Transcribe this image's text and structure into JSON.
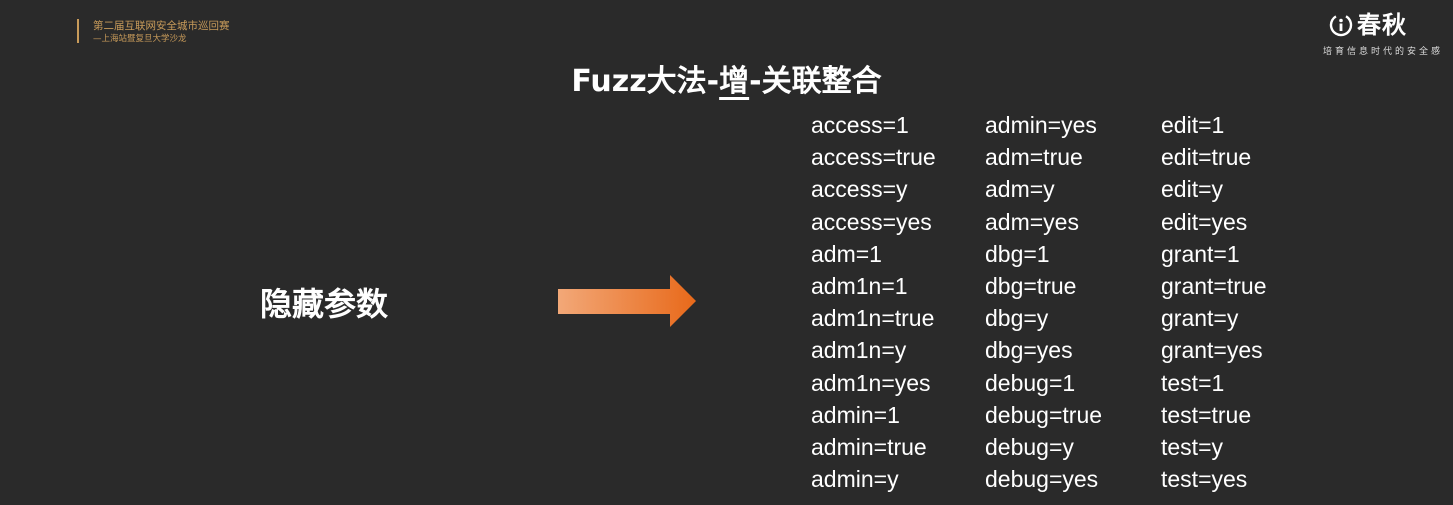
{
  "event": {
    "title": "第二届互联网安全城市巡回赛",
    "subtitle": "—上海站暨复旦大学沙龙"
  },
  "brand": {
    "name": "春秋",
    "slogan": "培育信息时代的安全感"
  },
  "slide": {
    "title_prefix": "Fuzz大法-",
    "title_emphasis": "增",
    "title_suffix": "-关联整合",
    "left_label": "隐藏参数"
  },
  "colors": {
    "background": "#2a2a2a",
    "accent_gold": "#c89b5a",
    "arrow_start": "#f2a878",
    "arrow_end": "#e8691a"
  },
  "params": {
    "columns": [
      [
        "access=1",
        "access=true",
        "access=y",
        "access=yes",
        "adm=1",
        "adm1n=1",
        "adm1n=true",
        "adm1n=y",
        "adm1n=yes",
        "admin=1",
        "admin=true",
        "admin=y"
      ],
      [
        "admin=yes",
        "adm=true",
        "adm=y",
        "adm=yes",
        "dbg=1",
        "dbg=true",
        "dbg=y",
        "dbg=yes",
        "debug=1",
        "debug=true",
        "debug=y",
        "debug=yes"
      ],
      [
        "edit=1",
        "edit=true",
        "edit=y",
        "edit=yes",
        "grant=1",
        "grant=true",
        "grant=y",
        "grant=yes",
        "test=1",
        "test=true",
        "test=y",
        "test=yes"
      ]
    ]
  }
}
